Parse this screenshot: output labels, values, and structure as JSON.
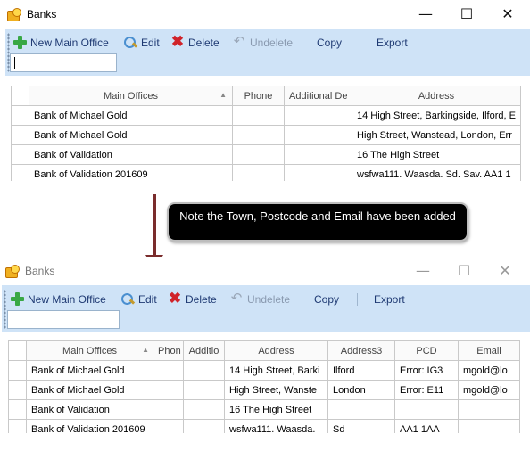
{
  "top_window": {
    "title": "Banks",
    "window_controls": {
      "minimize": "—",
      "maximize": "☐",
      "close": "✕"
    },
    "toolbar": {
      "new_main_office": "New Main Office",
      "edit": "Edit",
      "delete": "Delete",
      "undelete": "Undelete",
      "copy": "Copy",
      "export": "Export",
      "search_value": ""
    },
    "grid": {
      "columns": [
        "Main Offices",
        "Phone",
        "Additional De",
        "Address"
      ],
      "rows": [
        [
          "Bank of Michael Gold",
          "",
          "",
          "14 High Street, Barkingside, Ilford, E"
        ],
        [
          "Bank of Michael Gold",
          "",
          "",
          "High Street, Wanstead, London, Err"
        ],
        [
          "Bank of Validation",
          "",
          "",
          "16 The High Street"
        ],
        [
          "Bank of Validation 201609",
          "",
          "",
          "wsfwa111. Waasda. Sd. Sav. AA1 1"
        ]
      ]
    }
  },
  "callout": {
    "text": "Note the Town, Postcode and Email have been added"
  },
  "bottom_window": {
    "title": "Banks",
    "window_controls": {
      "minimize": "—",
      "maximize": "☐",
      "close": "✕"
    },
    "toolbar": {
      "new_main_office": "New Main Office",
      "edit": "Edit",
      "delete": "Delete",
      "undelete": "Undelete",
      "copy": "Copy",
      "export": "Export",
      "search_value": ""
    },
    "grid": {
      "columns": [
        "Main Offices",
        "Phon",
        "Additio",
        "Address",
        "Address3",
        "PCD",
        "Email"
      ],
      "rows": [
        [
          "Bank of Michael Gold",
          "",
          "",
          "14 High Street, Barki",
          "Ilford",
          "Error: IG3",
          "mgold@lo"
        ],
        [
          "Bank of Michael Gold",
          "",
          "",
          "High Street, Wanste",
          "London",
          "Error: E11",
          "mgold@lo"
        ],
        [
          "Bank of Validation",
          "",
          "",
          "16 The High Street",
          "",
          "",
          ""
        ],
        [
          "Bank of Validation 201609",
          "",
          "",
          "wsfwa111. Waasda.",
          "Sd",
          "AA1 1AA",
          ""
        ]
      ]
    }
  },
  "icons": {
    "app": "banks-app-icon",
    "new": "plus-icon",
    "edit": "magnifier-pencil-icon",
    "delete": "red-x-icon",
    "undelete": "undo-arrow-icon"
  },
  "colors": {
    "toolbar_bg": "#cfe3f7",
    "toolbar_text": "#1f3a73",
    "delete_icon": "#d0232a",
    "new_icon": "#39a845",
    "arrow": "#7a2c2c",
    "callout_bg": "#000000"
  }
}
